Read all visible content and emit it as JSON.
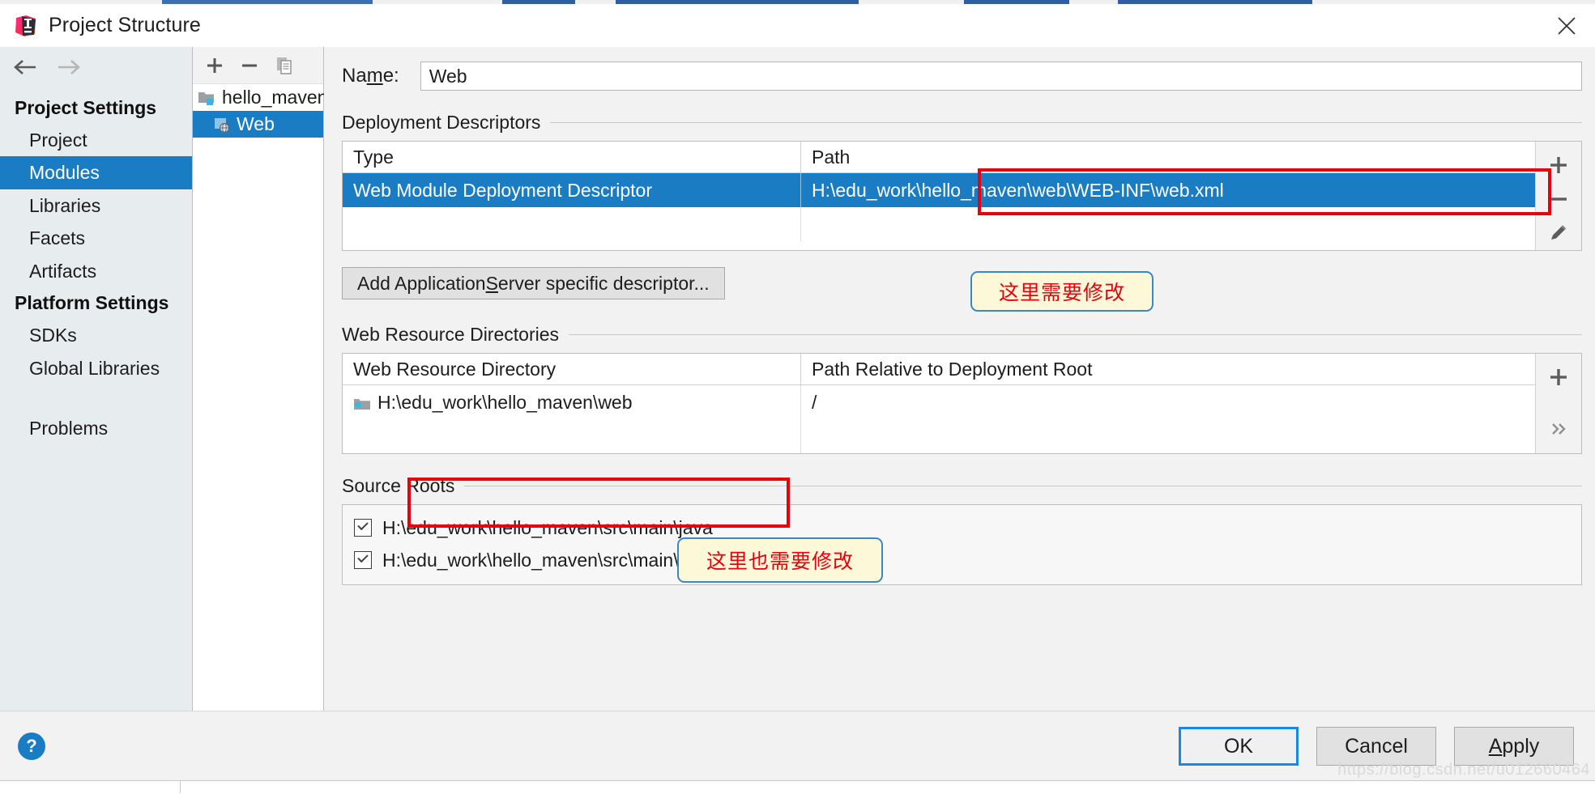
{
  "window": {
    "title": "Project Structure",
    "logo_icon": "intellij-idea-logo",
    "close_icon": "close-icon"
  },
  "nav_toolbar": {
    "back_icon": "arrow-left-icon",
    "forward_icon": "arrow-right-icon"
  },
  "sidebar": {
    "groups": [
      {
        "label": "Project Settings",
        "items": [
          {
            "label": "Project",
            "selected": false
          },
          {
            "label": "Modules",
            "selected": true
          },
          {
            "label": "Libraries",
            "selected": false
          },
          {
            "label": "Facets",
            "selected": false
          },
          {
            "label": "Artifacts",
            "selected": false
          }
        ]
      },
      {
        "label": "Platform Settings",
        "items": [
          {
            "label": "SDKs",
            "selected": false
          },
          {
            "label": "Global Libraries",
            "selected": false
          }
        ]
      }
    ],
    "extra_items": [
      {
        "label": "Problems",
        "selected": false
      }
    ]
  },
  "tree_panel": {
    "toolbar": [
      {
        "icon": "plus-icon",
        "name": "add-module-button"
      },
      {
        "icon": "minus-icon",
        "name": "remove-module-button"
      },
      {
        "icon": "copy-icon",
        "name": "copy-module-button"
      }
    ],
    "nodes": [
      {
        "label": "hello_maven",
        "icon": "module-folder-icon",
        "level": 0,
        "selected": false
      },
      {
        "label": "Web",
        "icon": "web-facet-icon",
        "level": 1,
        "selected": true
      }
    ]
  },
  "main": {
    "name_field": {
      "label_before": "Na",
      "label_mnemonic": "m",
      "label_after": "e:",
      "value": "Web"
    },
    "deployment_descriptors": {
      "title": "Deployment Descriptors",
      "columns": [
        "Type",
        "Path"
      ],
      "rows": [
        {
          "type": "Web Module Deployment Descriptor",
          "path": "H:\\edu_work\\hello_maven\\web\\WEB-INF\\web.xml",
          "selected": true
        }
      ],
      "tools": [
        {
          "icon": "plus-icon",
          "name": "add-descriptor-button"
        },
        {
          "icon": "minus-icon",
          "name": "remove-descriptor-button"
        },
        {
          "icon": "edit-pencil-icon",
          "name": "edit-descriptor-button"
        }
      ],
      "add_button": {
        "before": "Add Application ",
        "mnemonic": "S",
        "after": "erver specific descriptor..."
      }
    },
    "web_resource_directories": {
      "title": "Web Resource Directories",
      "columns": [
        "Web Resource Directory",
        "Path Relative to Deployment Root"
      ],
      "rows": [
        {
          "directory": "H:\\edu_work\\hello_maven\\web",
          "relative_path": "/",
          "icon": "folder-icon"
        }
      ],
      "tools": [
        {
          "icon": "plus-icon",
          "name": "add-web-resource-button"
        },
        {
          "icon": "chevron-double-right-icon",
          "name": "more-options-button"
        }
      ]
    },
    "source_roots": {
      "title": "Source Roots",
      "rows": [
        {
          "path": "H:\\edu_work\\hello_maven\\src\\main\\java",
          "checked": true
        },
        {
          "path": "H:\\edu_work\\hello_maven\\src\\main\\resources",
          "checked": true
        }
      ]
    }
  },
  "annotations": [
    {
      "text": "这里需要修改",
      "name": "annotation-descriptor-path"
    },
    {
      "text": "这里也需要修改",
      "name": "annotation-web-resource-dir"
    }
  ],
  "footer": {
    "help_label": "?",
    "ok_label": "OK",
    "cancel_label": "Cancel",
    "apply": {
      "mnemonic": "A",
      "rest": "pply"
    }
  },
  "watermark": "https://blog.csdn.net/u012660464",
  "colors": {
    "accent": "#1a7dc4",
    "annotation_red": "#e8000d",
    "callout_bg": "#fcf8d8",
    "callout_border": "#3a87c8",
    "sidebar_bg": "#e7ecef"
  }
}
